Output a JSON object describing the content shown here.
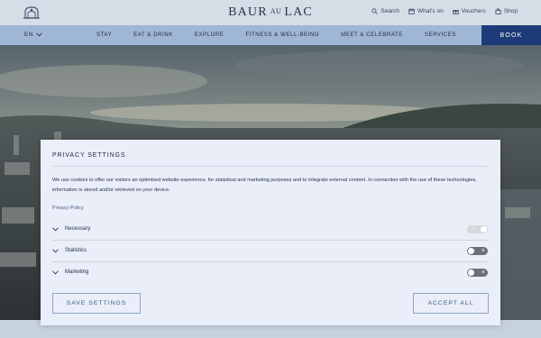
{
  "header": {
    "brand_left": "BAUR",
    "brand_mid": "AU",
    "brand_right": "LAC",
    "utility": [
      {
        "label": "Search",
        "icon": "search-icon"
      },
      {
        "label": "What's on",
        "icon": "calendar-icon"
      },
      {
        "label": "Vouchers",
        "icon": "gift-icon"
      },
      {
        "label": "Shop",
        "icon": "bag-icon"
      }
    ]
  },
  "nav": {
    "language": "EN",
    "items": [
      "STAY",
      "EAT & DRINK",
      "EXPLORE",
      "FITNESS & WELL-BEING",
      "MEET & CELEBRATE",
      "SERVICES"
    ],
    "book_label": "BOOK"
  },
  "privacy": {
    "title": "PRIVACY SETTINGS",
    "text": "We use cookies to offer our visitors an optimised website experience, for statistical and marketing purposes and to integrate external content. In connection with the use of these technologies, information is stored and/or retrieved on your device.",
    "policy_link": "Privacy Policy",
    "categories": [
      {
        "label": "Necessary",
        "enabled": true,
        "locked": true
      },
      {
        "label": "Statistics",
        "enabled": false,
        "locked": false
      },
      {
        "label": "Marketing",
        "enabled": false,
        "locked": false
      }
    ],
    "save_label": "SAVE SETTINGS",
    "accept_label": "ACCEPT ALL"
  },
  "colors": {
    "nav_bg": "#9fb6d4",
    "book_bg": "#1c3b78",
    "modal_bg": "#e9eef8",
    "toggle_off": "#6b6f78"
  }
}
